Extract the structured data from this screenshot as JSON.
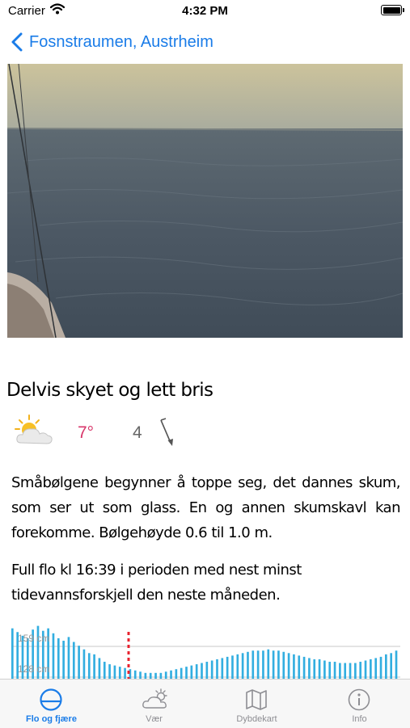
{
  "status_bar": {
    "carrier": "Carrier",
    "time": "4:32 PM"
  },
  "nav": {
    "title": "Fosnstraumen, Austrheim",
    "back_icon": "chevron-left-icon"
  },
  "weather": {
    "title": "Delvis skyet og lett bris",
    "icon": "partly-cloudy-icon",
    "temperature": "7°",
    "wind_speed": "4",
    "wind_icon": "wind-direction-arrow-icon",
    "description": "Småbølgene begynner å toppe seg, det dannes skum, som ser ut som glass. En og annen skumskavl kan forekomme. Bølgehøyde 0.6 til 1.0 m.",
    "tide_text": "Full flo kl 16:39 i perioden med nest minst tidevannsforskjell den neste måneden."
  },
  "tide_chart": {
    "label_high": "159 cm",
    "label_low": "128 cm"
  },
  "chart_data": {
    "type": "bar",
    "ylim": [
      118,
      165
    ],
    "values": [
      160,
      157,
      154,
      152,
      159,
      162,
      158,
      160,
      156,
      152,
      150,
      153,
      149,
      146,
      143,
      140,
      139,
      136,
      133,
      131,
      130,
      129,
      128,
      127,
      126,
      125,
      124,
      124,
      124,
      124,
      125,
      126,
      127,
      128,
      129,
      130,
      131,
      132,
      133,
      134,
      135,
      136,
      137,
      138,
      139,
      140,
      141,
      142,
      142,
      142,
      143,
      142,
      142,
      141,
      140,
      139,
      138,
      137,
      136,
      135,
      135,
      134,
      133,
      133,
      132,
      132,
      132,
      132,
      133,
      134,
      135,
      136,
      137,
      139,
      140,
      142
    ]
  },
  "tab_bar": {
    "tabs": [
      {
        "label": "Flo og fjære",
        "icon": "tide-icon",
        "active": true
      },
      {
        "label": "Vær",
        "icon": "weather-icon",
        "active": false
      },
      {
        "label": "Dybdekart",
        "icon": "map-icon",
        "active": false
      },
      {
        "label": "Info",
        "icon": "info-icon",
        "active": false
      }
    ]
  },
  "colors": {
    "accent": "#1a7ce8",
    "temperature": "#d8366a",
    "tide_bar": "#33aee0",
    "now_marker": "#e8222e"
  }
}
